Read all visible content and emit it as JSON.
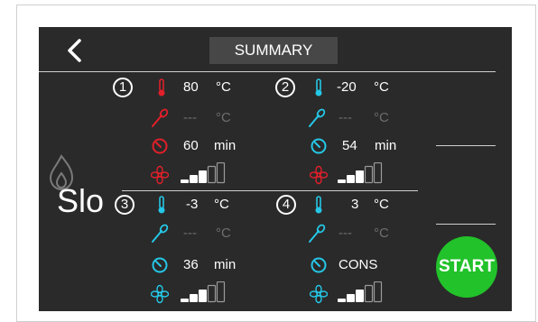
{
  "header": {
    "title": "SUMMARY"
  },
  "mode_label": "Slo",
  "start_label": "START",
  "colors": {
    "red": "#e0202a",
    "cyan": "#25c7e6",
    "green": "#22c22a",
    "background": "#2a2a2a"
  },
  "zones": [
    {
      "number": "1",
      "temp_value": "80",
      "temp_unit": "°C",
      "probe_value": "---",
      "probe_unit": "°C",
      "time_value": "60",
      "time_unit": "min",
      "icon_color": "red",
      "fan_level": 3
    },
    {
      "number": "2",
      "temp_value": "-20",
      "temp_unit": "°C",
      "probe_value": "---",
      "probe_unit": "°C",
      "time_value": "54",
      "time_unit": "min",
      "icon_color": "mixed",
      "fan_level": 3
    },
    {
      "number": "3",
      "temp_value": "-3",
      "temp_unit": "°C",
      "probe_value": "---",
      "probe_unit": "°C",
      "time_value": "36",
      "time_unit": "min",
      "icon_color": "cyan",
      "fan_level": 3
    },
    {
      "number": "4",
      "temp_value": "3",
      "temp_unit": "°C",
      "probe_value": "---",
      "probe_unit": "°C",
      "time_value": "CONS",
      "time_unit": "",
      "icon_color": "cyan",
      "fan_level": 3
    }
  ]
}
